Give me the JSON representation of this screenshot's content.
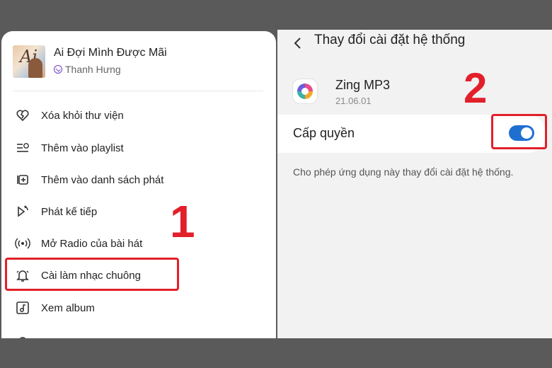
{
  "left": {
    "song": {
      "title": "Ai Đợi Mình Được Mãi",
      "artist": "Thanh Hưng"
    },
    "menu": [
      {
        "label": "Xóa khỏi thư viện",
        "icon": "heart-broken-icon"
      },
      {
        "label": "Thêm vào playlist",
        "icon": "playlist-add-icon"
      },
      {
        "label": "Thêm vào danh sách phát",
        "icon": "queue-add-icon"
      },
      {
        "label": "Phát kế tiếp",
        "icon": "play-next-icon"
      },
      {
        "label": "Mở Radio của bài hát",
        "icon": "radio-icon"
      },
      {
        "label": "Cài làm nhạc chuông",
        "icon": "bell-icon"
      },
      {
        "label": "Xem album",
        "icon": "album-icon"
      }
    ],
    "step_number": "1"
  },
  "right": {
    "back_glyph": "<",
    "title": "Thay đổi cài đặt hệ thống",
    "app": {
      "name": "Zing MP3",
      "version": "21.06.01"
    },
    "permission": {
      "label": "Cấp quyền",
      "enabled": true,
      "description": "Cho phép ứng dụng này thay đổi cài đặt hệ thống."
    },
    "step_number": "2"
  },
  "colors": {
    "highlight": "#e2202a",
    "toggle_on": "#1f6fd1",
    "backdrop": "#5a5a5a"
  }
}
